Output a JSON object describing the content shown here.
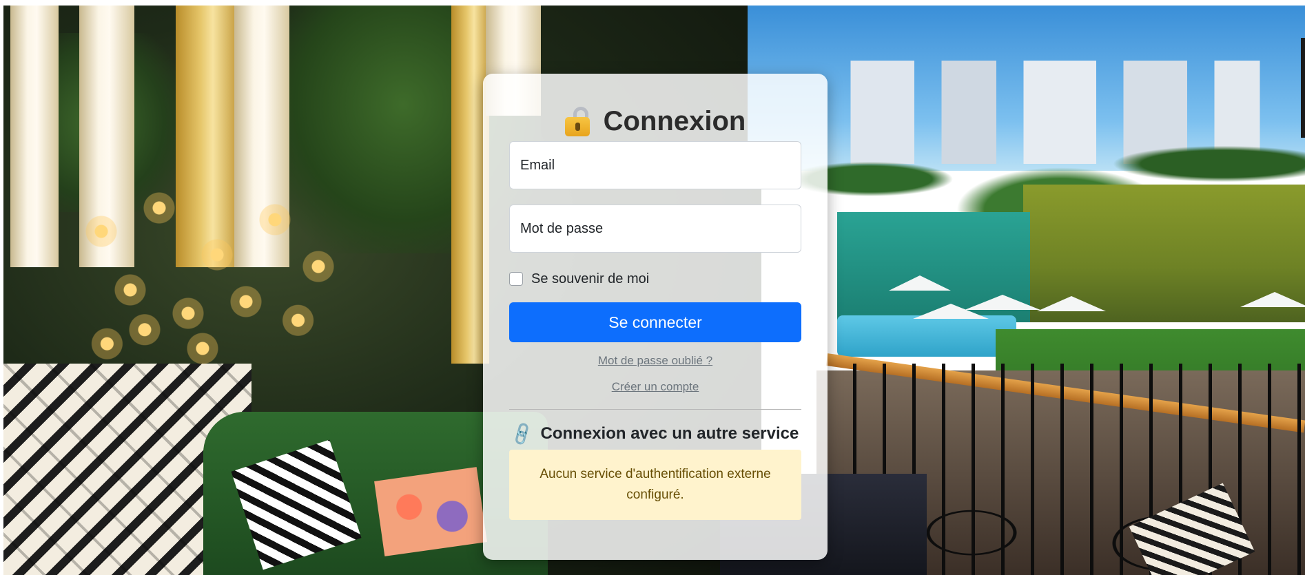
{
  "page": {
    "title": "Connexion",
    "lock_icon": "lock-icon"
  },
  "form": {
    "email_placeholder": "Email",
    "email_value": "",
    "password_placeholder": "Mot de passe",
    "password_value": "",
    "remember_label": "Se souvenir de moi",
    "remember_checked": false,
    "submit_label": "Se connecter",
    "forgot_link": "Mot de passe oublié ?",
    "create_link": "Créer un compte"
  },
  "external": {
    "icon": "link-icon",
    "title": "Connexion avec un autre service",
    "notice": "Aucun service d'authentification externe configuré."
  },
  "colors": {
    "primary": "#0d6efd",
    "notice_bg": "#fff3cd",
    "notice_text": "#664d03",
    "link": "#6c757d"
  }
}
